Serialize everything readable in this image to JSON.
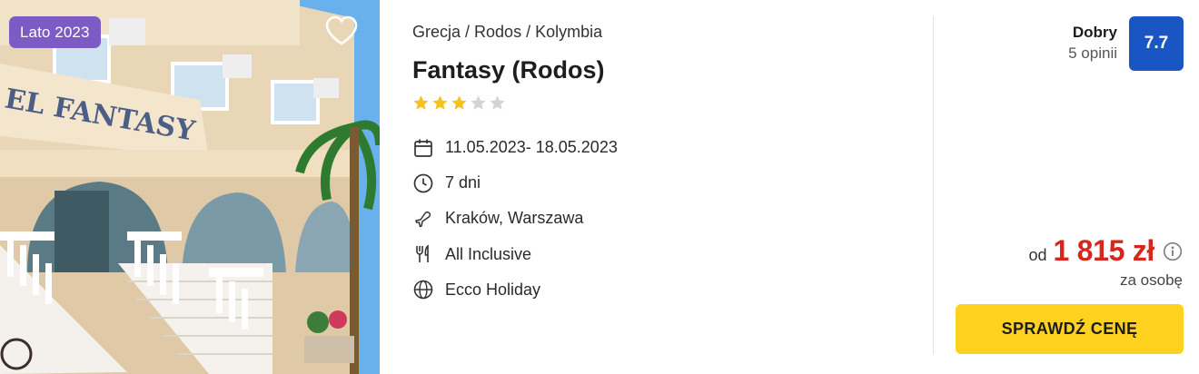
{
  "offer": {
    "season_badge": "Lato 2023",
    "breadcrumb": [
      "Grecja",
      "Rodos",
      "Kolymbia"
    ],
    "hotel_name": "Fantasy (Rodos)",
    "stars_filled": 3,
    "stars_total": 5,
    "photo_sign_text": "EL FANTASY"
  },
  "info": {
    "dates": "11.05.2023- 18.05.2023",
    "duration": "7 dni",
    "departure": "Kraków, Warszawa",
    "board": "All Inclusive",
    "operator": "Ecco Holiday"
  },
  "icons": {
    "favorite": "heart-icon",
    "dates": "calendar-icon",
    "duration": "clock-icon",
    "departure": "plane-icon",
    "board": "cutlery-icon",
    "operator": "globe-icon",
    "price_info": "info-icon",
    "star": "star-icon"
  },
  "rating": {
    "label": "Dobry",
    "reviews": "5 opinii",
    "score": "7.7"
  },
  "price": {
    "prefix": "od",
    "value": "1 815 zł",
    "unit": "za osobę"
  },
  "cta": {
    "label": "SPRAWDŹ CENĘ"
  },
  "colors": {
    "badge": "#7c5cc4",
    "score_bg": "#1a56c3",
    "price": "#d9261c",
    "cta_bg": "#ffd21f",
    "star_on": "#f7c21a",
    "star_off": "#d4d4d4"
  }
}
